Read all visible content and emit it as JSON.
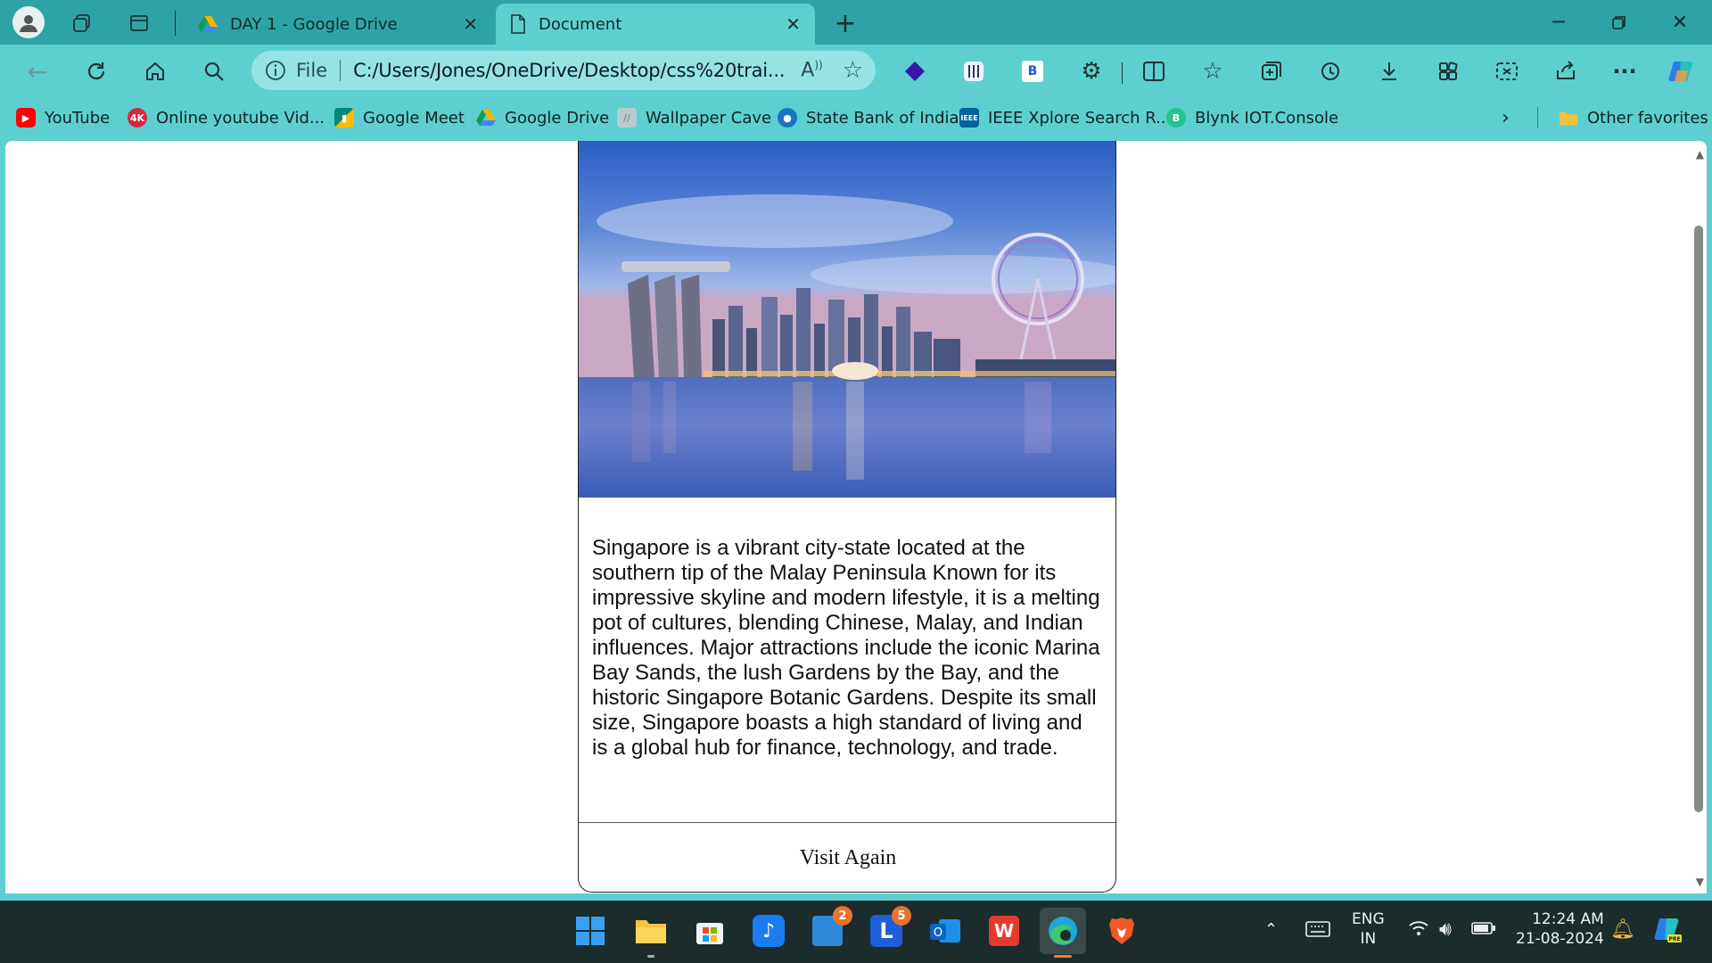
{
  "browser": {
    "tabs": [
      {
        "label": "DAY 1 - Google Drive",
        "icon": "google-drive-icon",
        "active": false
      },
      {
        "label": "Document",
        "icon": "document-icon",
        "active": true
      }
    ],
    "address": {
      "scheme_label": "File",
      "url": "C:/Users/Jones/OneDrive/Desktop/css%20trai..."
    },
    "bookmarks": [
      {
        "label": "YouTube",
        "icon": "youtube-icon",
        "color": "#ff0000"
      },
      {
        "label": "Online youtube Vid...",
        "icon": "4k-downloader-icon",
        "color": "#d7263d"
      },
      {
        "label": "Google Meet",
        "icon": "google-meet-icon",
        "color": "#00897b"
      },
      {
        "label": "Google Drive",
        "icon": "google-drive-icon",
        "color": "#f4b400"
      },
      {
        "label": "Wallpaper Cave",
        "icon": "wallpaper-cave-icon",
        "color": "#b9c9cc"
      },
      {
        "label": "State Bank of India",
        "icon": "sbi-icon",
        "color": "#1a75bc"
      },
      {
        "label": "IEEE Xplore Search R...",
        "icon": "ieee-icon",
        "color": "#00629b"
      },
      {
        "label": "Blynk IOT.Console",
        "icon": "blynk-icon",
        "color": "#23c48e"
      }
    ],
    "other_favorites": "Other favorites"
  },
  "card": {
    "image_alt": "Singapore skyline at dusk with Marina Bay Sands and Singapore Flyer",
    "text": "Singapore is a vibrant city-state located at the southern tip of the Malay Peninsula Known for its impressive skyline and modern lifestyle, it is a melting pot of cultures, blending Chinese, Malay, and Indian influences. Major attractions include the iconic Marina Bay Sands, the lush Gardens by the Bay, and the historic Singapore Botanic Gardens. Despite its small size, Singapore boasts a high standard of living and is a global hub for finance, technology, and trade.",
    "footer": "Visit Again"
  },
  "taskbar": {
    "badges": {
      "store": "2",
      "l_app": "5"
    },
    "language": {
      "line1": "ENG",
      "line2": "IN"
    },
    "time": "12:24 AM",
    "date": "21-08-2024"
  }
}
